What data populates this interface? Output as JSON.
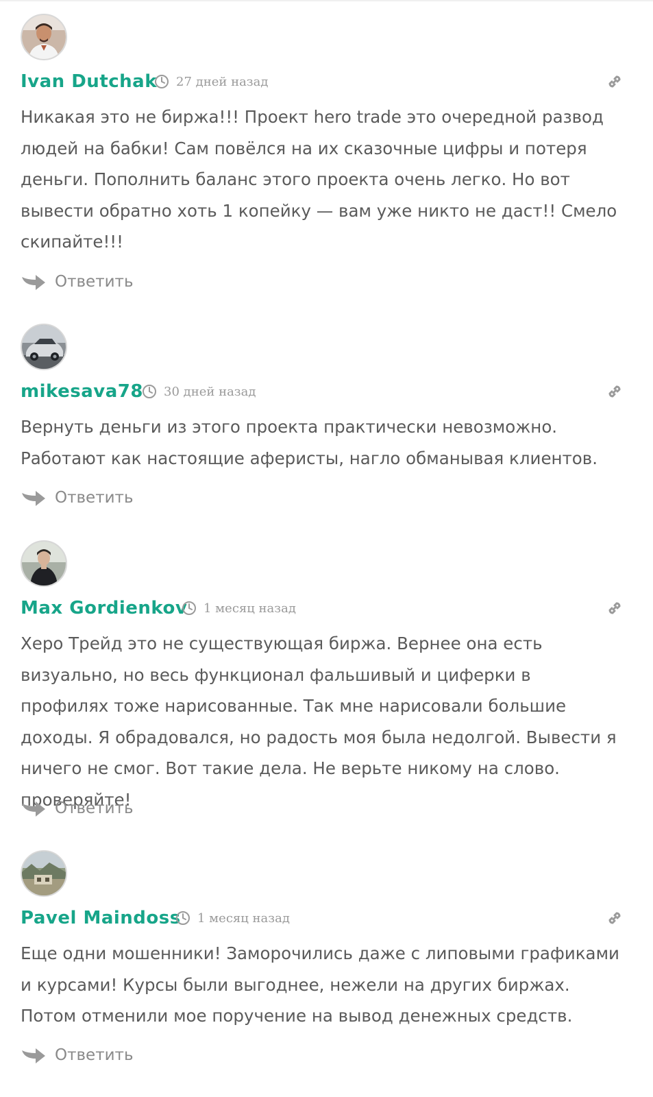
{
  "colors": {
    "author": "#17a589",
    "text": "#5a5a5a",
    "meta": "#9a9a9a",
    "icon": "#9a9a9a"
  },
  "comments": [
    {
      "author": "Ivan Dutchak",
      "time": "27 дней назад",
      "text": "Никакая это не биржа!!! Проект hero trade это очередной развод людей на бабки! Сам повёлся на их сказочные цифры и потеря деньги. Пополнить баланс этого проекта очень легко. Но вот вывести обратно хоть 1 копейку — вам уже никто не даст!! Смело скипайте!!!",
      "reply_label": "Ответить",
      "avatar_icon": "person-photo"
    },
    {
      "author": "mikesava78",
      "time": "30 дней назад",
      "text": "Вернуть деньги из этого проекта практически невозможно. Работают как настоящие аферисты, нагло обманывая клиентов.",
      "reply_label": "Ответить",
      "avatar_icon": "car-photo"
    },
    {
      "author": "Max Gordienkov",
      "time": "1 месяц назад",
      "text": "Херо Трейд это не существующая биржа. Вернее она есть визуально, но весь функционал фальшивый и циферки в профилях тоже нарисованные. Так мне нарисовали большие доходы. Я обрадовался, но радость моя была недолгой. Вывести я ничего не смог. Вот такие дела. Не верьте никому на слово. проверяйте!",
      "reply_label": "Ответить",
      "avatar_icon": "person-photo"
    },
    {
      "author": "Pavel Maindoss",
      "time": "1 месяц назад",
      "text": "Еще одни мошенники! Заморочились даже с липовыми графиками и курсами! Курсы были выгоднее, нежели на других биржах. Потом отменили мое поручение на вывод денежных средств.",
      "reply_label": "Ответить",
      "avatar_icon": "landscape-photo"
    }
  ]
}
